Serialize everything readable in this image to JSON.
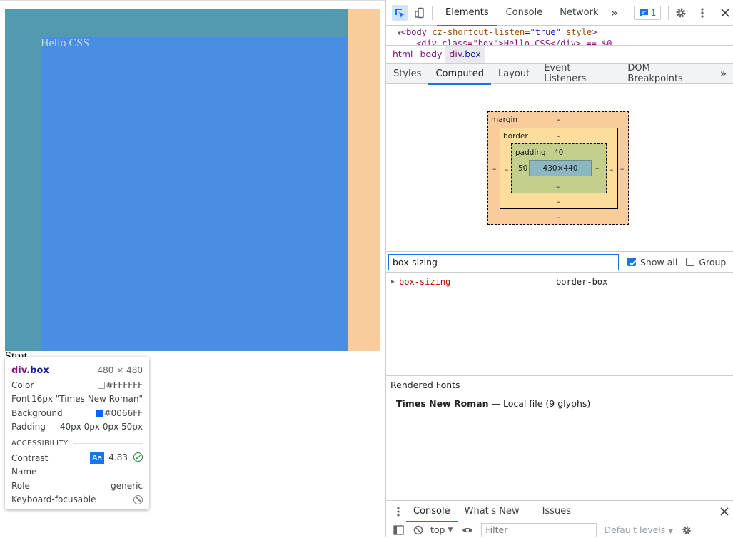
{
  "page": {
    "hello_text": "Hello CSS",
    "under_text": "Strut"
  },
  "tooltip": {
    "tag": "div",
    "class": ".box",
    "size": "480 × 480",
    "rows": [
      {
        "label": "Color",
        "value": "#FFFFFF",
        "swatch": "#FFFFFF"
      },
      {
        "label": "Font",
        "value": "16px \"Times New Roman\""
      },
      {
        "label": "Background",
        "value": "#0066FF",
        "swatch": "#0066FF"
      },
      {
        "label": "Padding",
        "value": "40px 0px 0px 50px"
      }
    ],
    "accessibility": {
      "section_label": "ACCESSIBILITY",
      "contrast_label": "Contrast",
      "contrast_badge": "Aa",
      "contrast_value": "4.83",
      "name_label": "Name",
      "name_value": "",
      "role_label": "Role",
      "role_value": "generic",
      "focusable_label": "Keyboard-focusable"
    }
  },
  "devtools": {
    "main_tabs": [
      "Elements",
      "Console",
      "Network"
    ],
    "more_tabs": "»",
    "issues_count": "1",
    "dom": {
      "line1_tag": "body",
      "line1_attr1": "cz-shortcut-listen",
      "line1_val1": "\"true\"",
      "line1_attr2": "style",
      "line2": "<div class=\"box\">Hello CSS</div> == $0"
    },
    "breadcrumbs": [
      "html",
      "body"
    ],
    "breadcrumb_active_tag": "div",
    "breadcrumb_active_class": ".box",
    "sub_tabs": [
      "Styles",
      "Computed",
      "Layout",
      "Event Listeners",
      "DOM Breakpoints"
    ],
    "sub_more": "»",
    "box_model": {
      "margin_label": "margin",
      "border_label": "border",
      "padding_label": "padding",
      "margin_top": "–",
      "margin_bottom": "–",
      "margin_left": "–",
      "margin_right": "–",
      "border_top": "–",
      "border_bottom": "–",
      "border_left": "–",
      "border_right": "–",
      "padding_top": "40",
      "padding_bottom": "–",
      "padding_left": "50",
      "padding_right": "–",
      "content": "430×440"
    },
    "filter": {
      "value": "box-sizing",
      "show_all_label": "Show all",
      "group_label": "Group"
    },
    "computed_property": {
      "name": "box-sizing",
      "value": "border-box"
    },
    "rendered_fonts": {
      "heading": "Rendered Fonts",
      "font_name": "Times New Roman",
      "dash": "—",
      "source": "Local file",
      "glyphs": "(9 glyphs)"
    },
    "drawer_tabs": [
      "Console",
      "What's New",
      "Issues"
    ],
    "console_toolbar": {
      "context": "top",
      "filter_placeholder": "Filter",
      "levels": "Default levels"
    }
  },
  "colors": {
    "margin": "#f9cc9d",
    "padding": "#5399b0",
    "content": "#4a8ee4",
    "accent": "#1a73e8"
  }
}
